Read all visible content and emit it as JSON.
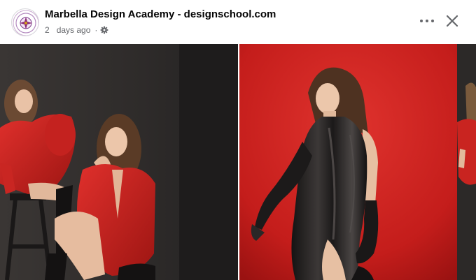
{
  "post": {
    "page_name": "Marbella Design Academy - designschool.com",
    "timestamp_number": "2",
    "timestamp_unit": "days ago",
    "separator": "·",
    "privacy_icon": "gear-icon"
  },
  "actions": {
    "more_icon": "more-horizontal-icon",
    "close_icon": "close-icon"
  },
  "gallery": {
    "photos": [
      {
        "subject": "two models in red leather outfits posing on a stool"
      },
      {
        "subject": "model in black satin dress and long black gloves on red backdrop"
      },
      {
        "subject": "partial view of model in red outfit"
      }
    ]
  },
  "colors": {
    "text_primary": "#050505",
    "text_secondary": "#65676b",
    "backdrop_red": "#c9201f",
    "backdrop_dark": "#2b2827"
  }
}
